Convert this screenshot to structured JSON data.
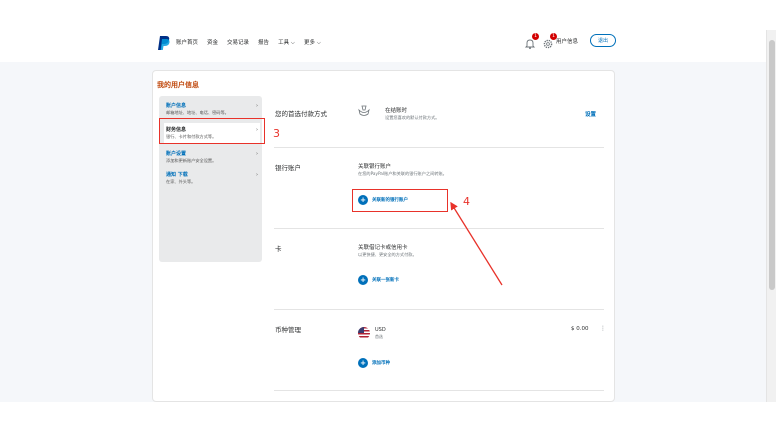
{
  "header": {
    "nav": [
      "账户首页",
      "资金",
      "交易记录",
      "报告",
      "工具 ⌵",
      "更多 ⌵"
    ],
    "notification_count": "1",
    "settings_count": "1",
    "user_label": "用户信息",
    "logout": "退出"
  },
  "card": {
    "title": "我的用户信息"
  },
  "sidebar": {
    "items": [
      {
        "title": "账户信息",
        "subtitle": "邮箱地址、地址、电话、密码等。"
      },
      {
        "title": "财务信息",
        "subtitle": "银行、卡片和付款方式等。"
      },
      {
        "title": "账户设置",
        "subtitle": "添加和更新账户安全设置。"
      },
      {
        "title": "通知 下载",
        "subtitle": "在家、外头等。"
      }
    ]
  },
  "annotations": {
    "step3": "3",
    "step4": "4"
  },
  "preferred": {
    "label": "您的首选付款方式",
    "title": "在结账时",
    "subtitle": "设置您喜欢的默认付款方式。",
    "link": "设置"
  },
  "bank": {
    "label": "银行账户",
    "title": "关联银行账户",
    "subtitle": "在您的PayPal账户和关联的银行账户之间转账。",
    "action": "关联新的银行账户"
  },
  "cards": {
    "label": "卡",
    "title": "关联借记卡或信用卡",
    "subtitle": "以更快捷、更安全的方式付款。",
    "action": "关联一张新卡"
  },
  "currency": {
    "label": "币种管理",
    "code": "USD",
    "sub": "首选",
    "amount": "$ 0.00",
    "more": "⋮",
    "action": "添加币种"
  },
  "colors": {
    "accent": "#0070ba",
    "highlight": "#e8322a",
    "title": "#c0490e",
    "band": "#f5f7fa"
  }
}
